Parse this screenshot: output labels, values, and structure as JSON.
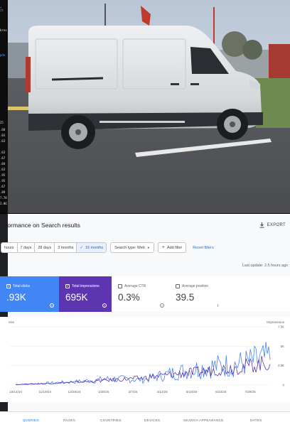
{
  "left_strip": {
    "top_labels": [
      "•",
      "Jt",
      "bros",
      "pda"
    ],
    "numbers": [
      "25",
      ".68",
      ".03",
      ".63",
      ".63",
      ".67",
      ".04",
      ".63",
      ".95",
      ".95",
      ".67",
      ".89",
      "7.78",
      "3.06"
    ]
  },
  "header": {
    "title": "rformance on Search results",
    "export_label": "EXPORT"
  },
  "filters": {
    "ranges": [
      "hours",
      "7 days",
      "28 days",
      "3 months",
      "16 months"
    ],
    "active_range_mark": "✓",
    "search_type": "Search type: Web",
    "add_filter": "Add filter",
    "reset": "Reset filters"
  },
  "last_update": "Last update: 2.5 hours ago",
  "metrics": [
    {
      "label": "Total clicks",
      "value": ".93K",
      "checked": true,
      "color": "#4285f4"
    },
    {
      "label": "Total impressions",
      "value": "695K",
      "checked": true,
      "color": "#5e35b1"
    },
    {
      "label": "Average CTR",
      "value": "0.3%",
      "checked": false
    },
    {
      "label": "Average position",
      "value": "39.5",
      "checked": false
    }
  ],
  "chart_data": {
    "type": "line",
    "left_axis_label": "icks",
    "right_axis_label": "Impressions",
    "right_ticks": [
      "7.5K",
      "5K",
      "2.5K",
      "0"
    ],
    "right_ylim": [
      0,
      7500
    ],
    "x": [
      "10/14/24",
      "11/19/24",
      "12/25/24",
      "1/30/25",
      "3/7/25",
      "4/12/25",
      "5/18/25",
      "6/23/25",
      "7/29/25"
    ],
    "series": [
      {
        "name": "Total clicks",
        "color": "#4285f4",
        "values": [
          80,
          250,
          450,
          800,
          700,
          1600,
          2300,
          2700,
          3500
        ]
      },
      {
        "name": "Total impressions",
        "color": "#5e35b1",
        "values": [
          60,
          200,
          400,
          650,
          900,
          1400,
          1800,
          2300,
          2900
        ]
      }
    ]
  },
  "tabs": [
    "QUERIES",
    "PAGES",
    "COUNTRIES",
    "DEVICES",
    "SEARCH APPEARANCE",
    "DATES"
  ],
  "colors": {
    "clicks": "#4285f4",
    "impressions": "#5e35b1",
    "link": "#1a73e8"
  }
}
